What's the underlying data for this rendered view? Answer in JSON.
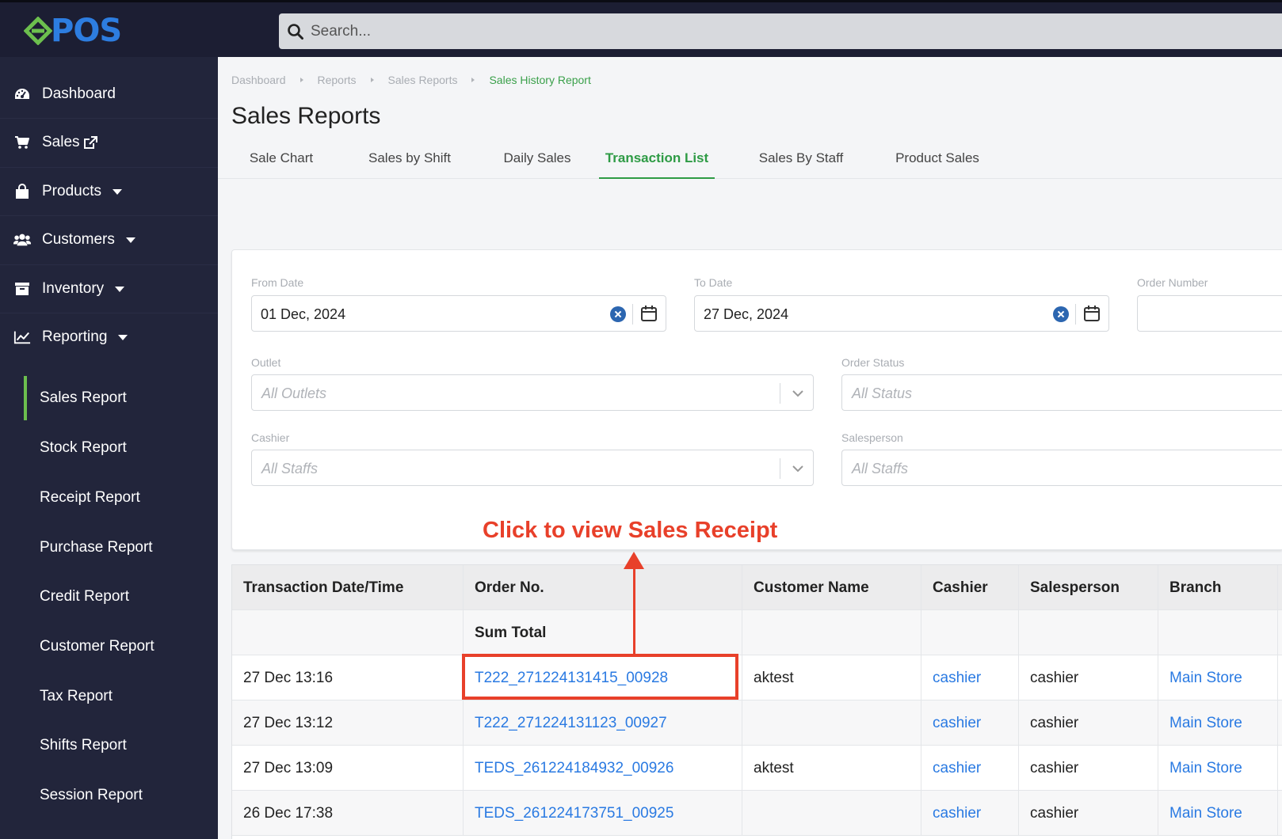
{
  "app": {
    "logo_text": "POS",
    "logo_letter": "e",
    "search": {
      "placeholder": "Search..."
    }
  },
  "sidebar": {
    "items": [
      {
        "label": "Dashboard",
        "icon": "dashboard-icon"
      },
      {
        "label": "Sales",
        "icon": "cart-icon",
        "external": true
      },
      {
        "label": "Products",
        "icon": "shopping-bag-icon",
        "caret": true
      },
      {
        "label": "Customers",
        "icon": "users-icon",
        "caret": true
      },
      {
        "label": "Inventory",
        "icon": "archive-icon",
        "caret": true
      },
      {
        "label": "Reporting",
        "icon": "line-chart-icon",
        "caret": true
      }
    ],
    "sub_items": [
      {
        "label": "Sales Report",
        "active": true
      },
      {
        "label": "Stock Report"
      },
      {
        "label": "Receipt Report"
      },
      {
        "label": "Purchase Report"
      },
      {
        "label": "Credit Report"
      },
      {
        "label": "Customer Report"
      },
      {
        "label": "Tax Report"
      },
      {
        "label": "Shifts Report"
      },
      {
        "label": "Session Report"
      }
    ]
  },
  "breadcrumb": [
    "Dashboard",
    "Reports",
    "Sales Reports",
    "Sales History Report"
  ],
  "page_title": "Sales Reports",
  "tabs": [
    {
      "label": "Sale Chart"
    },
    {
      "label": "Sales by Shift"
    },
    {
      "label": "Daily Sales"
    },
    {
      "label": "Transaction List",
      "active": true
    },
    {
      "label": "Sales By Staff"
    },
    {
      "label": "Product Sales"
    }
  ],
  "filters": {
    "from_date": {
      "label": "From Date",
      "value": "01 Dec, 2024"
    },
    "to_date": {
      "label": "To Date",
      "value": "27 Dec, 2024"
    },
    "order_number": {
      "label": "Order Number",
      "value": ""
    },
    "outlet": {
      "label": "Outlet",
      "placeholder": "All Outlets"
    },
    "order_status": {
      "label": "Order Status",
      "placeholder": "All Status"
    },
    "cashier": {
      "label": "Cashier",
      "placeholder": "All Staffs"
    },
    "salesperson": {
      "label": "Salesperson",
      "placeholder": "All Staffs"
    }
  },
  "annotation": {
    "text": "Click to view Sales Receipt",
    "color": "#e8402a"
  },
  "table": {
    "headers": [
      "Transaction Date/Time",
      "Order No.",
      "Customer Name",
      "Cashier",
      "Salesperson",
      "Branch"
    ],
    "sum_row": {
      "label": "Sum Total"
    },
    "rows": [
      {
        "datetime": "27 Dec 13:16",
        "order_no": "T222_271224131415_00928",
        "customer": "aktest",
        "cashier": "cashier",
        "salesperson": "cashier",
        "branch": "Main Store"
      },
      {
        "datetime": "27 Dec 13:12",
        "order_no": "T222_271224131123_00927",
        "customer": "",
        "cashier": "cashier",
        "salesperson": "cashier",
        "branch": "Main Store"
      },
      {
        "datetime": "27 Dec 13:09",
        "order_no": "TEDS_261224184932_00926",
        "customer": "aktest",
        "cashier": "cashier",
        "salesperson": "cashier",
        "branch": "Main Store"
      },
      {
        "datetime": "26 Dec 17:38",
        "order_no": "TEDS_261224173751_00925",
        "customer": "",
        "cashier": "cashier",
        "salesperson": "cashier",
        "branch": "Main Store"
      }
    ]
  },
  "colors": {
    "sidebar_bg": "#22253b",
    "topbar_bg": "#1c1e33",
    "accent_green": "#2e9b45",
    "link_blue": "#2a7ae2",
    "logo_blue": "#2d7de0",
    "logo_green": "#6cbf4e"
  }
}
